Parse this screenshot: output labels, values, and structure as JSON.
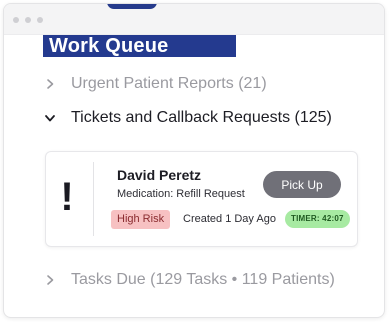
{
  "title": "Work Queue",
  "sections": {
    "urgent": {
      "label": "Urgent Patient Reports (21)"
    },
    "tickets": {
      "label": "Tickets and Callback Requests (125)"
    },
    "tasks": {
      "label": "Tasks Due (129 Tasks • 119 Patients)"
    }
  },
  "ticket": {
    "alert_symbol": "!",
    "patient_name": "David Peretz",
    "medication": "Medication: Refill Request",
    "pickup_label": "Pick Up",
    "risk_label": "High Risk",
    "created": "Created 1 Day Ago",
    "timer": "TIMER: 42:07"
  },
  "colors": {
    "header_band": "#243a8f",
    "risk_bg": "#f7c1c2",
    "timer_bg": "#a7eaa2",
    "pickup_bg": "#707078"
  }
}
